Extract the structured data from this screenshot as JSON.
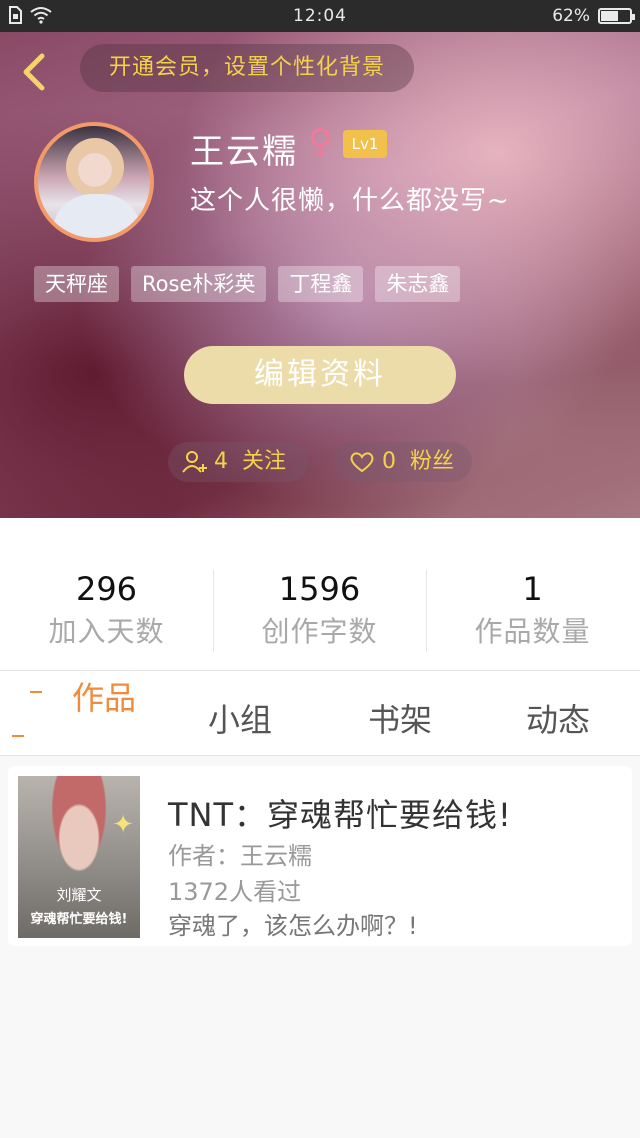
{
  "status_bar": {
    "time": "12:04",
    "battery": "62%",
    "battery_level": 0.62
  },
  "header": {
    "vip_banner": "开通会员，设置个性化背景",
    "username": "王云糯",
    "gender_symbol": "♀",
    "level": "Lv1",
    "bio": "这个人很懒，什么都没写~",
    "tags": [
      "天秤座",
      "Rose朴彩英",
      "丁程鑫",
      "朱志鑫"
    ],
    "edit_button": "编辑资料",
    "follow_count": "4",
    "follow_label": "关注",
    "fans_count": "0",
    "fans_label": "粉丝"
  },
  "stats": [
    {
      "value": "296",
      "label": "加入天数"
    },
    {
      "value": "1596",
      "label": "创作字数"
    },
    {
      "value": "1",
      "label": "作品数量"
    }
  ],
  "tabs": [
    {
      "label": "作品",
      "active": true
    },
    {
      "label": "小组",
      "active": false
    },
    {
      "label": "书架",
      "active": false
    },
    {
      "label": "动态",
      "active": false
    }
  ],
  "works": [
    {
      "title": "TNT：穿魂帮忙要给钱!",
      "author": "作者：王云糯",
      "views": "1372人看过",
      "description": "穿魂了，该怎么办啊？!",
      "cover_text_1": "刘耀文",
      "cover_text_2": "穿魂帮忙要给钱!"
    }
  ],
  "colors": {
    "accent_orange": "#f28a3c",
    "accent_yellow": "#f4d24c",
    "avatar_ring": "#f39a6a",
    "level_badge": "#f2c14b"
  }
}
